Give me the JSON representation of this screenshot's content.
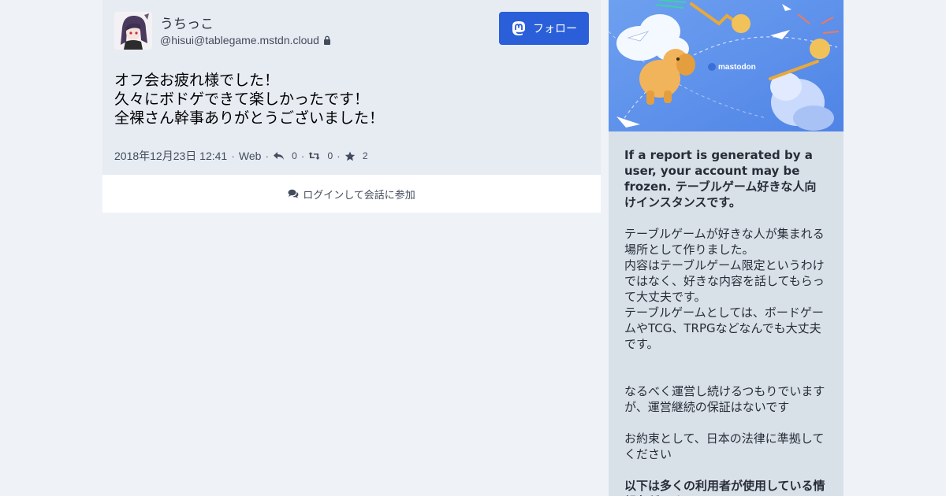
{
  "account": {
    "display_name": "うちっこ",
    "acct": "@hisui@tablegame.mstdn.cloud",
    "locked": true
  },
  "follow_button": {
    "label": "フォロー",
    "icon": "mastodon-icon",
    "color": "#2b5fd9"
  },
  "status": {
    "lines": [
      "オフ会お疲れ様でした！",
      "久々にボドゲできて楽しかったです！",
      "全裸さん幹事ありがとうございました！"
    ],
    "timestamp": "2018年12月23日 12:41",
    "application": "Web",
    "replies": "0",
    "reblogs": "0",
    "favourites": "2"
  },
  "login_prompt": {
    "label": "ログインして会話に参加",
    "icon": "comments-icon"
  },
  "server": {
    "hero_logo_text": "mastodon",
    "description_bold": "If a report is generated by a user, your account may be frozen. テーブルゲーム好きな人向けインスタンスです。",
    "description_1": "テーブルゲームが好きな人が集まれる場所として作りました。\n内容はテーブルゲーム限定というわけではなく、好きな内容を話してもらって大丈夫です。\nテーブルゲームとしては、ボードゲームやTCG、TRPGなどなんでも大丈夫です。",
    "description_2": "なるべく運営し続けるつもりでいますが、運営継続の保証はないです",
    "description_3": "お約束として、日本の法律に準拠してください",
    "description_4_bold": "以下は多くの利用者が使用している情報各種です。"
  }
}
